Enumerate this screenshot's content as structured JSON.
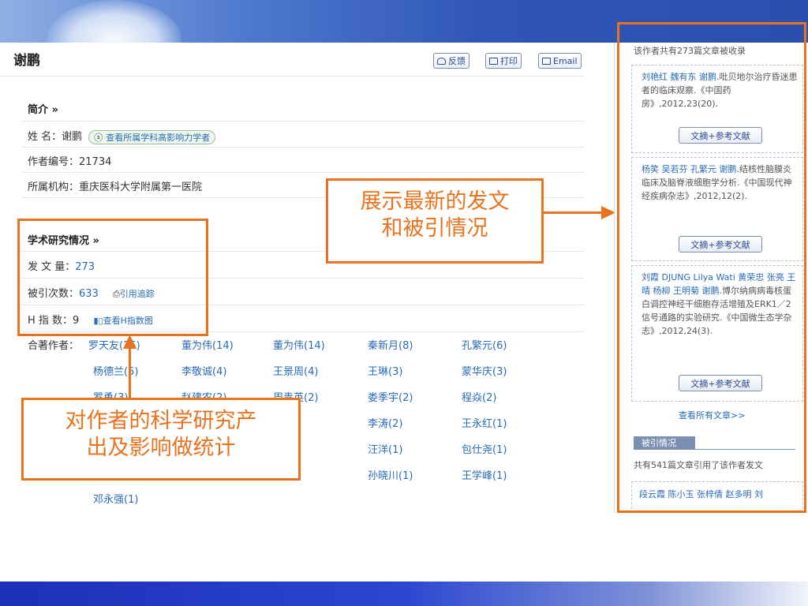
{
  "author": {
    "name": "谢鹏"
  },
  "toolbar": {
    "feedback": "反馈",
    "print": "打印",
    "email": "Email"
  },
  "intro": {
    "title": "简介 »",
    "name_label": "姓 名：",
    "name_value": "谢鹏",
    "scholar_link": "查看所属学科高影响力学者",
    "id_label": "作者编号：",
    "id_value": "21734",
    "org_label": "所属机构：",
    "org_value": "重庆医科大学附属第一医院"
  },
  "research": {
    "title": "学术研究情况 »",
    "papers_label": "发 文 量：",
    "papers_value": "273",
    "cited_label": "被引次数：",
    "cited_value": "633",
    "cite_track": "引用追踪",
    "h_label": "H 指 数：",
    "h_value": "9",
    "h_link": "查看H指数图"
  },
  "coauthors": {
    "label": "合著作者：",
    "items": [
      "罗天友(25)",
      "董为伟(14)",
      "董为伟(14)",
      "秦新月(8)",
      "孔繁元(6)",
      "杨德兰(5)",
      "李敬诚(4)",
      "王景周(4)",
      "王琳(3)",
      "蒙华庆(3)",
      "罗勇(3)",
      "赵建农(2)",
      "周青英(2)",
      "娄季宇(2)",
      "程焱(2)",
      "",
      "",
      "勤(2)",
      "李涛(2)",
      "王永红(1)",
      "",
      "",
      "新(1)",
      "汪洋(1)",
      "包仕尧(1)",
      "",
      "",
      "玉(1)",
      "孙晓川(1)",
      "王学峰(1)",
      "邓永强(1)"
    ]
  },
  "callouts": {
    "latest": [
      "展示最新的发文",
      "和被引情况"
    ],
    "stats": [
      "对作者的科学研究产",
      "出及影响做统计"
    ]
  },
  "sidebar": {
    "header": "该作者共有273篇文章被收录",
    "articles": [
      {
        "authors": "刘艳红 魏有东 谢鹏",
        "text": ".吡贝地尔治疗昏迷患者的临床观察.《中国药房》,2012,23(20).",
        "button": "文摘+参考文献"
      },
      {
        "authors": "杨笑 吴若芬 孔繁元 谢鹏",
        "text": ".结核性脑膜炎临床及脑脊液细胞学分析.《中国现代神经疾病杂志》,2012,12(2).",
        "button": "文摘+参考文献"
      },
      {
        "authors": "刘霞 DJUNG Lilya Wati 黄荣忠 张亮 王晴 杨柳 王明菊 谢鹏",
        "text": ".博尔纳病病毒核蛋白调控神经干细胞存活增殖及ERK1／2信号通路的实验研究.《中国微生态学杂志》,2012,24(3).",
        "button": "文摘+参考文献"
      }
    ],
    "view_all": "查看所有文章>>",
    "cited_tab": "被引情况",
    "cited_summary": "共有541篇文章引用了该作者发文",
    "cited_first": "段云霞 陈小玉 张梓倩 赵多明 刘"
  },
  "colors": {
    "accent": "#e8731f",
    "link": "#2a6bb5",
    "banner": "#2f56b6"
  }
}
